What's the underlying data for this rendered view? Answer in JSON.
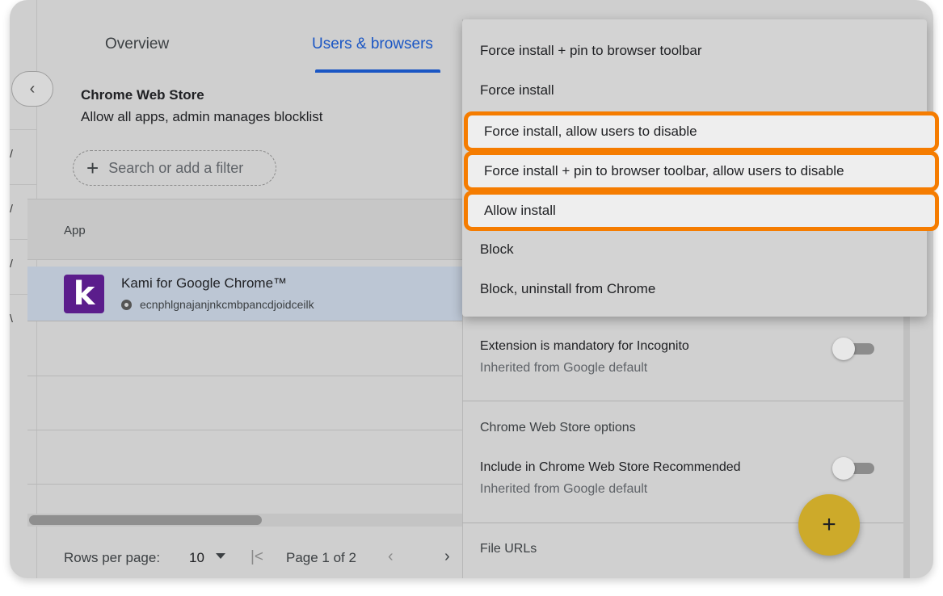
{
  "tabs": {
    "overview": "Overview",
    "users": "Users & browsers"
  },
  "store": {
    "title": "Chrome Web Store",
    "subtitle": "Allow all apps, admin manages blocklist"
  },
  "filter": {
    "placeholder": "Search or add a filter"
  },
  "table": {
    "col_app": "App",
    "row": {
      "logo": "k",
      "name": "Kami for Google Chrome™",
      "id": "ecnphlgnajanjnkcmbpancdjoidceilk"
    }
  },
  "pager": {
    "rows_label": "Rows per page:",
    "rows_value": "10",
    "page_label": "Page 1 of 2"
  },
  "menu": {
    "items": [
      "Force install + pin to browser toolbar",
      "Force install",
      "Force install, allow users to disable",
      "Force install + pin to browser toolbar, allow users to disable",
      "Allow install",
      "Block",
      "Block, uninstall from Chrome"
    ]
  },
  "settings": {
    "incognito_title": "Extension is mandatory for Incognito",
    "incognito_sub": "Inherited from Google default",
    "cws_section": "Chrome Web Store options",
    "recommended_title": "Include in Chrome Web Store Recommended",
    "recommended_sub": "Inherited from Google default",
    "file_urls": "File URLs"
  },
  "colors": {
    "accent": "#1a56c4",
    "highlight": "#f57c00",
    "fab": "#cdaa2a",
    "logo": "#5b1d8c"
  },
  "icons": [
    "chevron-left-icon",
    "plus-icon",
    "chrome-icon",
    "caret-down-icon",
    "first-page-icon",
    "prev-page-icon",
    "next-page-icon",
    "add-icon"
  ]
}
